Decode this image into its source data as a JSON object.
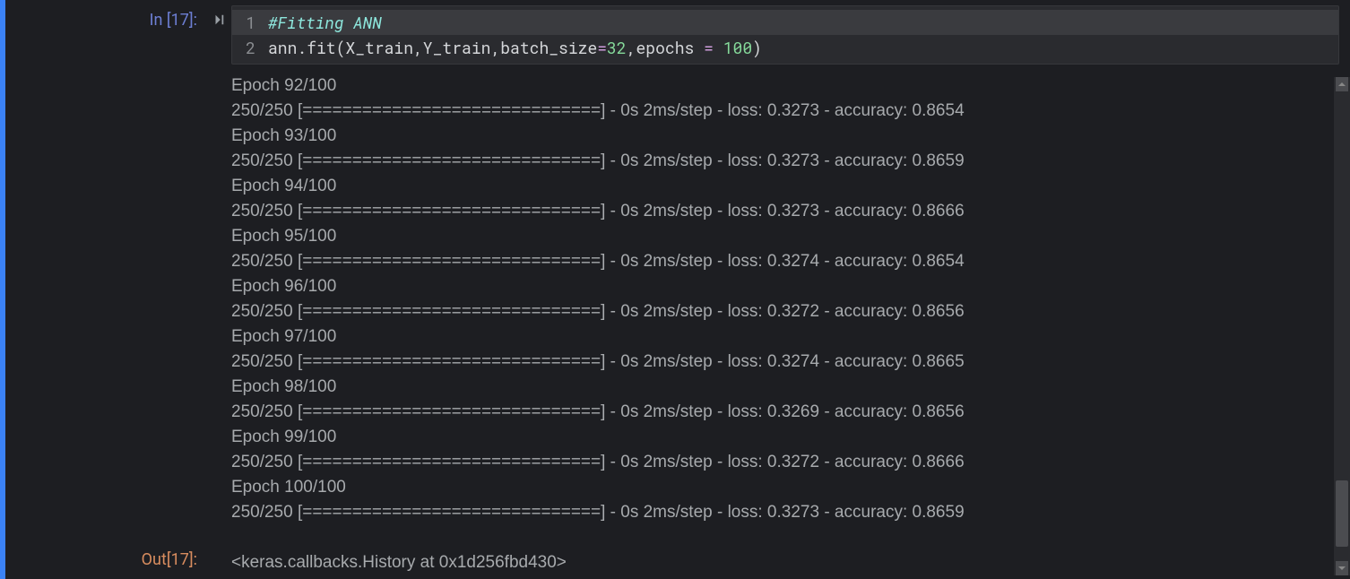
{
  "cell": {
    "in_prompt": "In [17]:",
    "out_prompt": "Out[17]:",
    "code": {
      "line1_gutter": "1",
      "line2_gutter": "2",
      "comment": "#Fitting ANN",
      "l2_a": "ann.fit(X_train,Y_train,batch_size",
      "l2_eq1": "=",
      "l2_n1": "32",
      "l2_b": ",epochs ",
      "l2_eq2": "= ",
      "l2_n2": "100",
      "l2_c": ")"
    },
    "stdout_lines": [
      "Epoch 92/100",
      "250/250 [==============================] - 0s 2ms/step - loss: 0.3273 - accuracy: 0.8654",
      "Epoch 93/100",
      "250/250 [==============================] - 0s 2ms/step - loss: 0.3273 - accuracy: 0.8659",
      "Epoch 94/100",
      "250/250 [==============================] - 0s 2ms/step - loss: 0.3273 - accuracy: 0.8666",
      "Epoch 95/100",
      "250/250 [==============================] - 0s 2ms/step - loss: 0.3274 - accuracy: 0.8654",
      "Epoch 96/100",
      "250/250 [==============================] - 0s 2ms/step - loss: 0.3272 - accuracy: 0.8656",
      "Epoch 97/100",
      "250/250 [==============================] - 0s 2ms/step - loss: 0.3274 - accuracy: 0.8665",
      "Epoch 98/100",
      "250/250 [==============================] - 0s 2ms/step - loss: 0.3269 - accuracy: 0.8656",
      "Epoch 99/100",
      "250/250 [==============================] - 0s 2ms/step - loss: 0.3272 - accuracy: 0.8666",
      "Epoch 100/100",
      "250/250 [==============================] - 0s 2ms/step - loss: 0.3273 - accuracy: 0.8659"
    ],
    "result": "<keras.callbacks.History at 0x1d256fbd430>"
  },
  "icons": {
    "run": "run-cell-icon"
  }
}
